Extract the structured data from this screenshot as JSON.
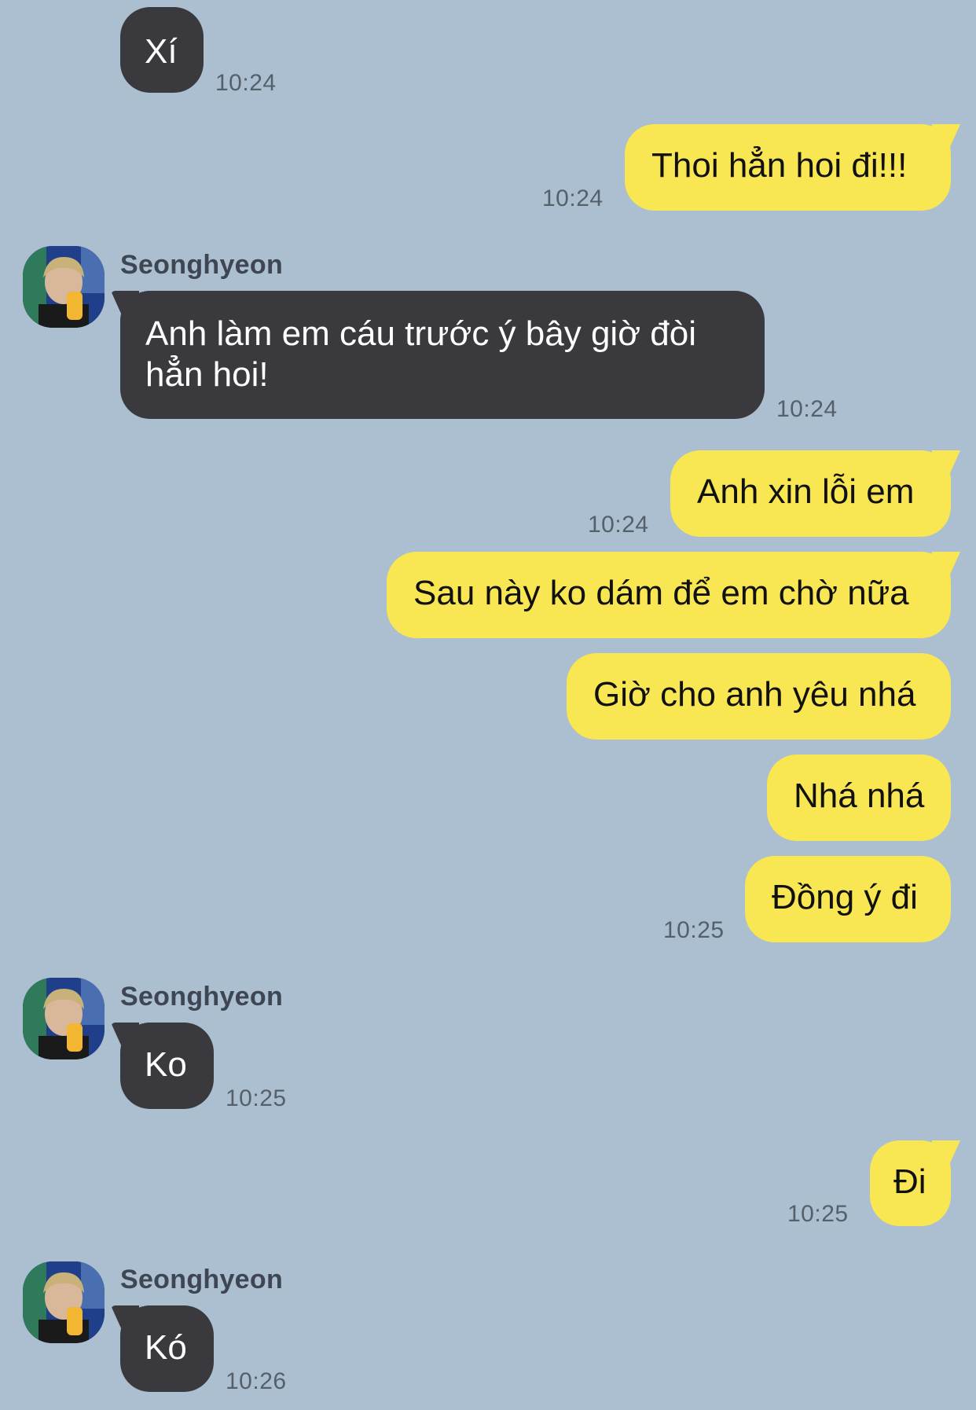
{
  "messages": [
    {
      "text": "Xí",
      "time": "10:24"
    },
    {
      "text": "Thoi hẳn hoi đi!!!",
      "time": "10:24"
    },
    {
      "sender": "Seonghyeon",
      "text": "Anh làm em cáu trước ý bây giờ đòi hẳn hoi!",
      "time": "10:24"
    },
    {
      "text": "Anh xin lỗi em",
      "time": "10:24"
    },
    {
      "text": "Sau này ko dám để em chờ nữa"
    },
    {
      "text": "Giờ cho anh yêu nhá"
    },
    {
      "text": "Nhá nhá"
    },
    {
      "text": "Đồng ý đi",
      "time": "10:25"
    },
    {
      "sender": "Seonghyeon",
      "text": "Ko",
      "time": "10:25"
    },
    {
      "text": "Đi",
      "time": "10:25"
    },
    {
      "sender": "Seonghyeon",
      "text": "Kó",
      "time": "10:26"
    }
  ],
  "colors": {
    "background": "#abbfd0",
    "incoming_bubble": "#3a3a3e",
    "outgoing_bubble": "#f8e653"
  }
}
